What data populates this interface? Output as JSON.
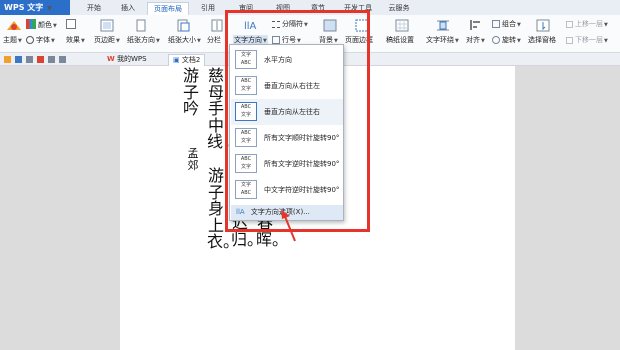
{
  "app": {
    "name": "WPS 文字"
  },
  "menu_tabs": [
    "开始",
    "插入",
    "页面布局",
    "引用",
    "审阅",
    "视图",
    "章节",
    "开发工具",
    "云服务"
  ],
  "ribbon": {
    "theme": "主题",
    "colors": "颜色",
    "fonts": "字体",
    "effects": "效果",
    "margins": "页边距",
    "orientation": "纸张方向",
    "size": "纸张大小",
    "columns": "分栏",
    "text_direction": "文字方向",
    "separator": "分隔符",
    "line_numbers": "行号",
    "background": "背景",
    "page_border": "页面边框",
    "manuscript": "稿纸设置",
    "text_wrap": "文字环绕",
    "align": "对齐",
    "combine": "组合",
    "rotate": "旋转",
    "select_pane": "选择窗格",
    "bring_forward": "上移一层",
    "send_backward": "下移一层"
  },
  "doc_tabs": [
    "我的WPS",
    "文档2"
  ],
  "document": {
    "col1_title": "游子吟",
    "col1_author": "孟郊",
    "col2": "慈母手中线，",
    "col3": "游子身上衣。",
    "col_right1": "迟归。",
    "col_right2": "春晖。"
  },
  "text_direction_menu": {
    "items": [
      {
        "label": "水平方向",
        "icon_text": "文字\nABC"
      },
      {
        "label": "垂直方向从右往左",
        "icon_text": "ABC\n文字"
      },
      {
        "label": "垂直方向从左往右",
        "icon_text": "ABC\n文字"
      },
      {
        "label": "所有文字顺时针旋转90°",
        "icon_text": "ABC\n文字"
      },
      {
        "label": "所有文字逆时针旋转90°",
        "icon_text": "ABC\n文字"
      },
      {
        "label": "中文字符逆时针旋转90°",
        "icon_text": "文字\nABC"
      }
    ],
    "options": "文字方向选项(X)..."
  },
  "colors": {
    "accent": "#2b6fc9",
    "highlight_box": "#e5352b",
    "menu_hover": "#dfe9f6"
  }
}
